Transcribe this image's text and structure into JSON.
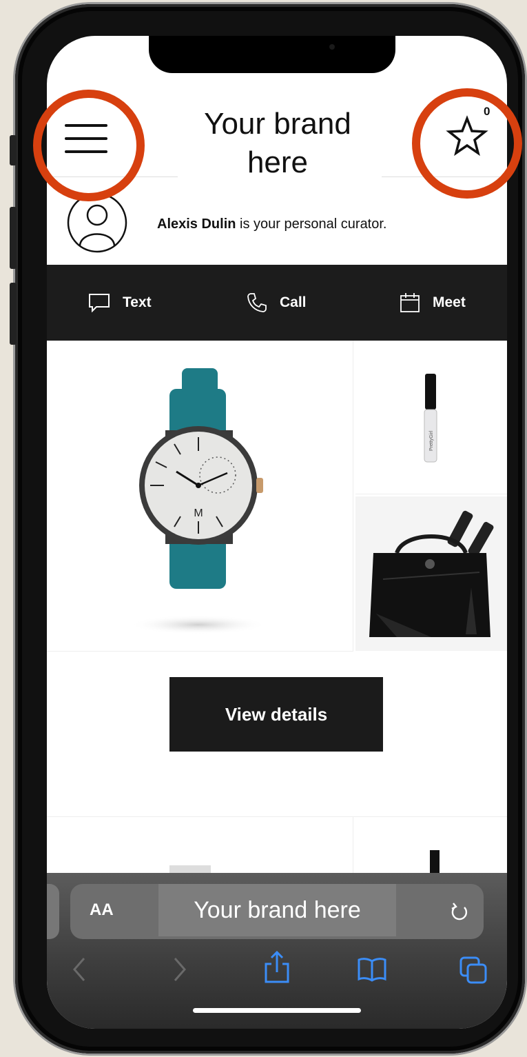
{
  "header": {
    "brand": "Your brand here",
    "favorites_count": "0"
  },
  "curator": {
    "name": "Alexis Dulin",
    "suffix": " is your personal curator."
  },
  "actions": {
    "text_label": "Text",
    "call_label": "Call",
    "meet_label": "Meet"
  },
  "products": {
    "details_label": "View details"
  },
  "browser": {
    "text_size_label": "AA",
    "url_text": "Your brand here"
  },
  "colors": {
    "highlight_ring": "#d7400f",
    "action_bar": "#1c1c1c",
    "safari_blue": "#3b8df7"
  },
  "icons": [
    "menu-icon",
    "star-icon",
    "avatar-icon",
    "chat-icon",
    "phone-icon",
    "calendar-icon",
    "reload-icon",
    "back-icon",
    "forward-icon",
    "share-icon",
    "bookmarks-icon",
    "tabs-icon"
  ]
}
